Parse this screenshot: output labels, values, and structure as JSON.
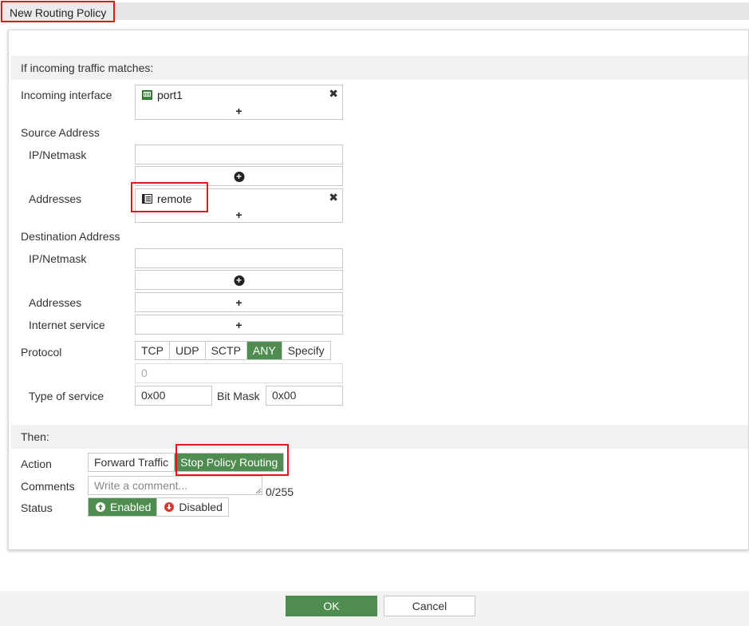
{
  "page": {
    "title": "New Routing Policy"
  },
  "match_section": {
    "heading": "If incoming traffic matches:"
  },
  "incoming_interface": {
    "label": "Incoming interface",
    "entries": [
      "port1"
    ]
  },
  "source": {
    "label": "Source Address",
    "ip_label": "IP/Netmask",
    "ip_value": "",
    "addresses_label": "Addresses",
    "addresses": [
      "remote"
    ]
  },
  "destination": {
    "label": "Destination Address",
    "ip_label": "IP/Netmask",
    "ip_value": "",
    "addresses_label": "Addresses",
    "internet_service_label": "Internet service"
  },
  "protocol": {
    "label": "Protocol",
    "options": [
      "TCP",
      "UDP",
      "SCTP",
      "ANY",
      "Specify"
    ],
    "selected": "ANY",
    "number_placeholder": "0"
  },
  "tos": {
    "label": "Type of service",
    "value": "0x00",
    "bitmask_label": "Bit Mask",
    "bitmask_value": "0x00"
  },
  "then_section": {
    "heading": "Then:"
  },
  "action": {
    "label": "Action",
    "options": [
      "Forward Traffic",
      "Stop Policy Routing"
    ],
    "selected": "Stop Policy Routing"
  },
  "comments": {
    "label": "Comments",
    "placeholder": "Write a comment...",
    "counter": "0/255"
  },
  "status": {
    "label": "Status",
    "enabled_label": "Enabled",
    "disabled_label": "Disabled",
    "selected": "Enabled"
  },
  "footer": {
    "ok_label": "OK",
    "cancel_label": "Cancel"
  },
  "colors": {
    "accent_green": "#4e8d4f",
    "highlight_red": "#e0161b"
  }
}
